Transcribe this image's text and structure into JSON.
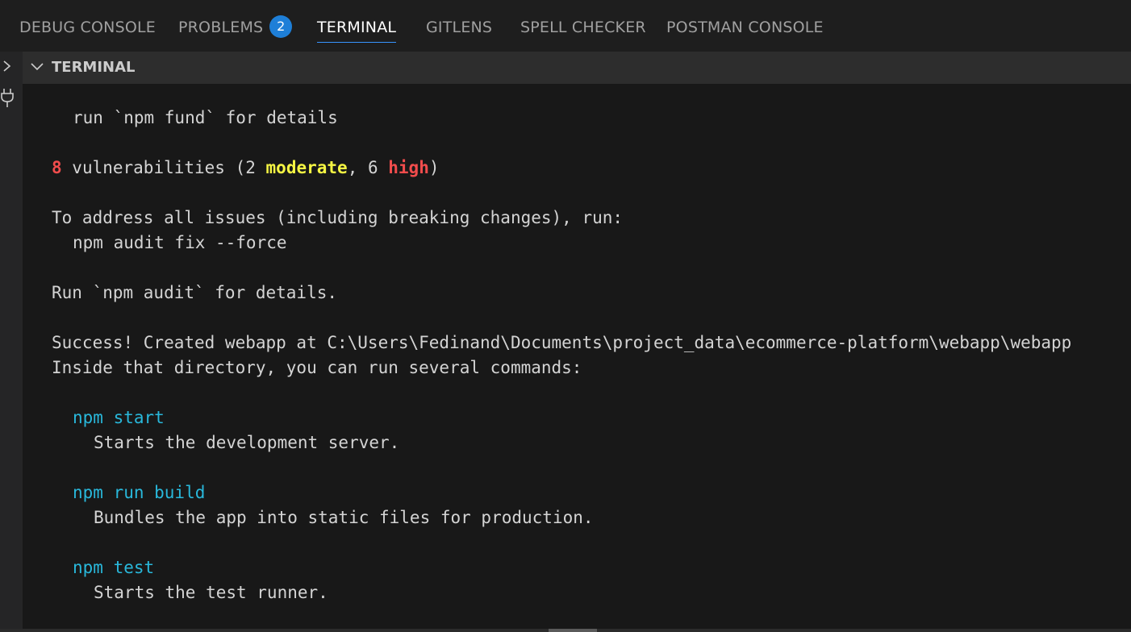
{
  "tabs": [
    {
      "label": "DEBUG CONSOLE"
    },
    {
      "label": "PROBLEMS",
      "badge": "2"
    },
    {
      "label": "TERMINAL",
      "active": true
    },
    {
      "label": "GITLENS"
    },
    {
      "label": "SPELL CHECKER"
    },
    {
      "label": "POSTMAN CONSOLE"
    }
  ],
  "section": {
    "title": "TERMINAL"
  },
  "icons": {
    "collapse": "chevron-right-icon",
    "section_toggle": "chevron-down-icon",
    "plug": "plug-icon"
  },
  "colors": {
    "error": "#f14c4c",
    "warning": "#f5f543",
    "command": "#29b8db",
    "accent": "#1e7fd8"
  },
  "terminal": {
    "fund_line": "run `npm fund` for details",
    "vuln": {
      "count": "8",
      "text_1": " vulnerabilities (2 ",
      "moderate": "moderate",
      "text_2": ", 6 ",
      "high": "high",
      "text_3": ")"
    },
    "address_line": "To address all issues (including breaking changes), run:",
    "fix_command": "npm audit fix --force",
    "audit_line": "Run `npm audit` for details.",
    "success_line": "Success! Created webapp at C:\\Users\\Fedinand\\Documents\\project_data\\ecommerce-platform\\webapp\\webapp",
    "inside_line": "Inside that directory, you can run several commands:",
    "commands": [
      {
        "command": "npm start",
        "description": "Starts the development server."
      },
      {
        "command": "npm run build",
        "description": "Bundles the app into static files for production."
      },
      {
        "command": "npm test",
        "description": "Starts the test runner."
      }
    ]
  }
}
